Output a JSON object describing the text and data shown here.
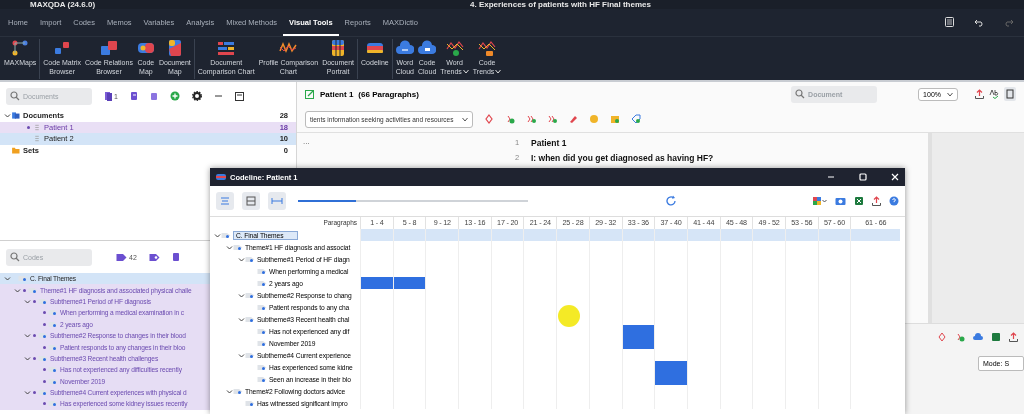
{
  "window": {
    "title": "MAXQDA (24.6.0)",
    "project": "4. Experiences of patients with HF Final themes"
  },
  "menu_tabs": [
    {
      "label": "Home",
      "selected": false
    },
    {
      "label": "Import",
      "selected": false
    },
    {
      "label": "Codes",
      "selected": false
    },
    {
      "label": "Memos",
      "selected": false
    },
    {
      "label": "Variables",
      "selected": false
    },
    {
      "label": "Analysis",
      "selected": false
    },
    {
      "label": "Mixed Methods",
      "selected": false
    },
    {
      "label": "Visual Tools",
      "selected": true
    },
    {
      "label": "Reports",
      "selected": false
    },
    {
      "label": "MAXDictio",
      "selected": false
    }
  ],
  "ribbon": [
    {
      "label": "MAXMaps",
      "dropdown": false
    },
    {
      "label": "Code Matrix\nBrowser",
      "dropdown": false
    },
    {
      "label": "Code Relations\nBrowser",
      "dropdown": false
    },
    {
      "label": "Code\nMap",
      "dropdown": false
    },
    {
      "label": "Document\nMap",
      "dropdown": false
    },
    {
      "label": "Document\nComparison Chart",
      "dropdown": false
    },
    {
      "label": "Profile Comparison\nChart",
      "dropdown": false
    },
    {
      "label": "Document\nPortrait",
      "dropdown": false
    },
    {
      "label": "Codeline",
      "dropdown": false
    },
    {
      "label": "Word\nCloud",
      "dropdown": false
    },
    {
      "label": "Code\nCloud",
      "dropdown": false
    },
    {
      "label": "Word\nTrends",
      "dropdown": true
    },
    {
      "label": "Code\nTrends",
      "dropdown": true
    }
  ],
  "document_system": {
    "search": {
      "placeholder": "Documents"
    },
    "count_badge": "1",
    "tree": [
      {
        "kind": "folder",
        "label": "Documents",
        "count": "28",
        "expanded": true,
        "children": [
          {
            "kind": "document",
            "label": "Patient 1",
            "count": "18",
            "selected": false,
            "activated": true
          },
          {
            "kind": "document",
            "label": "Patient 2",
            "count": "10",
            "selected": true,
            "activated": false
          }
        ]
      },
      {
        "kind": "set",
        "label": "Sets",
        "count": "0"
      }
    ]
  },
  "code_system": {
    "search": {
      "placeholder": "Codes"
    },
    "count_badge": "42",
    "tree": [
      {
        "label": "C. Final Themes",
        "expanded": true,
        "selected": true,
        "activated": false,
        "children": [
          {
            "label": "Theme#1 HF diagnosis and associated physical challe",
            "expanded": true,
            "selected": false,
            "activated": true,
            "children": [
              {
                "label": "Subtheme#1 Period of HF diagnosis",
                "expanded": true,
                "selected": false,
                "activated": true,
                "children": [
                  {
                    "label": "When performing a medical examination in c",
                    "selected": false,
                    "activated": true
                  },
                  {
                    "label": "2 years ago",
                    "selected": false,
                    "activated": true
                  }
                ]
              },
              {
                "label": "Subtheme#2 Response to changes in their blood",
                "expanded": true,
                "selected": false,
                "activated": true,
                "children": [
                  {
                    "label": "Patient responds to any changes in their bloo",
                    "selected": false,
                    "activated": true
                  }
                ]
              },
              {
                "label": "Subtheme#3 Recent health challenges",
                "expanded": true,
                "selected": false,
                "activated": true,
                "children": [
                  {
                    "label": "Has not experienced any difficulties recently",
                    "selected": false,
                    "activated": true
                  },
                  {
                    "label": "November 2019",
                    "selected": false,
                    "activated": true
                  }
                ]
              },
              {
                "label": "Subtheme#4 Current experiences with physical d",
                "expanded": true,
                "selected": false,
                "activated": true,
                "children": [
                  {
                    "label": "Has experienced some kidney issues recently",
                    "selected": false,
                    "activated": true
                  }
                ]
              }
            ]
          }
        ]
      }
    ]
  },
  "document_browser": {
    "title": "Patient 1",
    "paragraph_count": "(66 Paragraphs)",
    "search": {
      "placeholder": "Document"
    },
    "zoom": "100%",
    "code_dropdown": "tients information seeking activities and resources",
    "ellipsis": "...",
    "paragraphs": [
      {
        "number": "1",
        "text": "Patient 1"
      },
      {
        "number": "2",
        "text": "I: when did you get diagnosed as having HF?"
      }
    ]
  },
  "retrieved_segments": {
    "mode": "Mode: S"
  },
  "codeline": {
    "title": "Codeline: Patient 1",
    "zoom_slider": {
      "level": 0.25
    },
    "row_header": "Paragraphs",
    "columns": [
      "1 - 4",
      "5 - 8",
      "9 - 12",
      "13 - 16",
      "17 - 20",
      "21 - 24",
      "25 - 28",
      "29 - 32",
      "33 - 36",
      "37 - 40",
      "41 - 44",
      "45 - 48",
      "49 - 52",
      "53 - 56",
      "57 - 60",
      "61 - 66"
    ],
    "tree": [
      {
        "label": "C. Final Themes",
        "expanded": true,
        "selected": true,
        "coded": [
          false,
          false,
          false,
          false,
          false,
          false,
          false,
          false,
          false,
          false,
          false,
          false,
          false,
          false,
          false,
          false
        ],
        "children": [
          {
            "label": "Theme#1 HF diagnosis and associat",
            "expanded": true,
            "selected": false,
            "coded": [
              false,
              false,
              false,
              false,
              false,
              false,
              false,
              false,
              false,
              false,
              false,
              false,
              false,
              false,
              false,
              false
            ],
            "children": [
              {
                "label": "Subtheme#1 Period of HF diagn",
                "expanded": true,
                "selected": false,
                "coded": [
                  false,
                  false,
                  false,
                  false,
                  false,
                  false,
                  false,
                  false,
                  false,
                  false,
                  false,
                  false,
                  false,
                  false,
                  false,
                  false
                ],
                "children": [
                  {
                    "label": "When performing a medical",
                    "selected": false,
                    "coded": [
                      false,
                      false,
                      false,
                      false,
                      false,
                      false,
                      false,
                      false,
                      false,
                      false,
                      false,
                      false,
                      false,
                      false,
                      false,
                      false
                    ]
                  },
                  {
                    "label": "2 years ago",
                    "selected": false,
                    "coded": [
                      true,
                      true,
                      false,
                      false,
                      false,
                      false,
                      false,
                      false,
                      false,
                      false,
                      false,
                      false,
                      false,
                      false,
                      false,
                      false
                    ]
                  }
                ]
              },
              {
                "label": "Subtheme#2 Response to chang",
                "expanded": true,
                "selected": false,
                "coded": [
                  false,
                  false,
                  false,
                  false,
                  false,
                  false,
                  false,
                  false,
                  false,
                  false,
                  false,
                  false,
                  false,
                  false,
                  false,
                  false
                ],
                "children": [
                  {
                    "label": "Patient responds to any cha",
                    "selected": false,
                    "coded": [
                      false,
                      false,
                      false,
                      false,
                      false,
                      false,
                      false,
                      false,
                      false,
                      false,
                      false,
                      false,
                      false,
                      false,
                      false,
                      false
                    ]
                  }
                ]
              },
              {
                "label": "Subtheme#3 Recent health chal",
                "expanded": true,
                "selected": false,
                "coded": [
                  false,
                  false,
                  false,
                  false,
                  false,
                  false,
                  false,
                  false,
                  false,
                  false,
                  false,
                  false,
                  false,
                  false,
                  false,
                  false
                ],
                "children": [
                  {
                    "label": "Has not experienced any dif",
                    "selected": false,
                    "coded": [
                      false,
                      false,
                      false,
                      false,
                      false,
                      false,
                      false,
                      false,
                      true,
                      false,
                      false,
                      false,
                      false,
                      false,
                      false,
                      false
                    ]
                  },
                  {
                    "label": "November 2019",
                    "selected": false,
                    "coded": [
                      false,
                      false,
                      false,
                      false,
                      false,
                      false,
                      false,
                      false,
                      true,
                      false,
                      false,
                      false,
                      false,
                      false,
                      false,
                      false
                    ]
                  }
                ]
              },
              {
                "label": "Subtheme#4 Current experience",
                "expanded": true,
                "selected": false,
                "coded": [
                  false,
                  false,
                  false,
                  false,
                  false,
                  false,
                  false,
                  false,
                  false,
                  false,
                  false,
                  false,
                  false,
                  false,
                  false,
                  false
                ],
                "children": [
                  {
                    "label": "Has experienced some kidne",
                    "selected": false,
                    "coded": [
                      false,
                      false,
                      false,
                      false,
                      false,
                      false,
                      false,
                      false,
                      false,
                      true,
                      false,
                      false,
                      false,
                      false,
                      false,
                      false
                    ]
                  },
                  {
                    "label": "Seen an increase in their blo",
                    "selected": false,
                    "coded": [
                      false,
                      false,
                      false,
                      false,
                      false,
                      false,
                      false,
                      false,
                      false,
                      true,
                      false,
                      false,
                      false,
                      false,
                      false,
                      false
                    ]
                  }
                ]
              }
            ]
          },
          {
            "label": "Theme#2 Following doctors advice",
            "expanded": true,
            "selected": false,
            "coded": [
              false,
              false,
              false,
              false,
              false,
              false,
              false,
              false,
              false,
              false,
              false,
              false,
              false,
              false,
              false,
              false
            ],
            "children": [
              {
                "label": "Has witnessed significant impro",
                "selected": false,
                "coded": [
                  false,
                  false,
                  false,
                  false,
                  false,
                  false,
                  false,
                  false,
                  false,
                  false,
                  false,
                  false,
                  false,
                  false,
                  false,
                  false
                ]
              }
            ]
          }
        ]
      }
    ]
  }
}
